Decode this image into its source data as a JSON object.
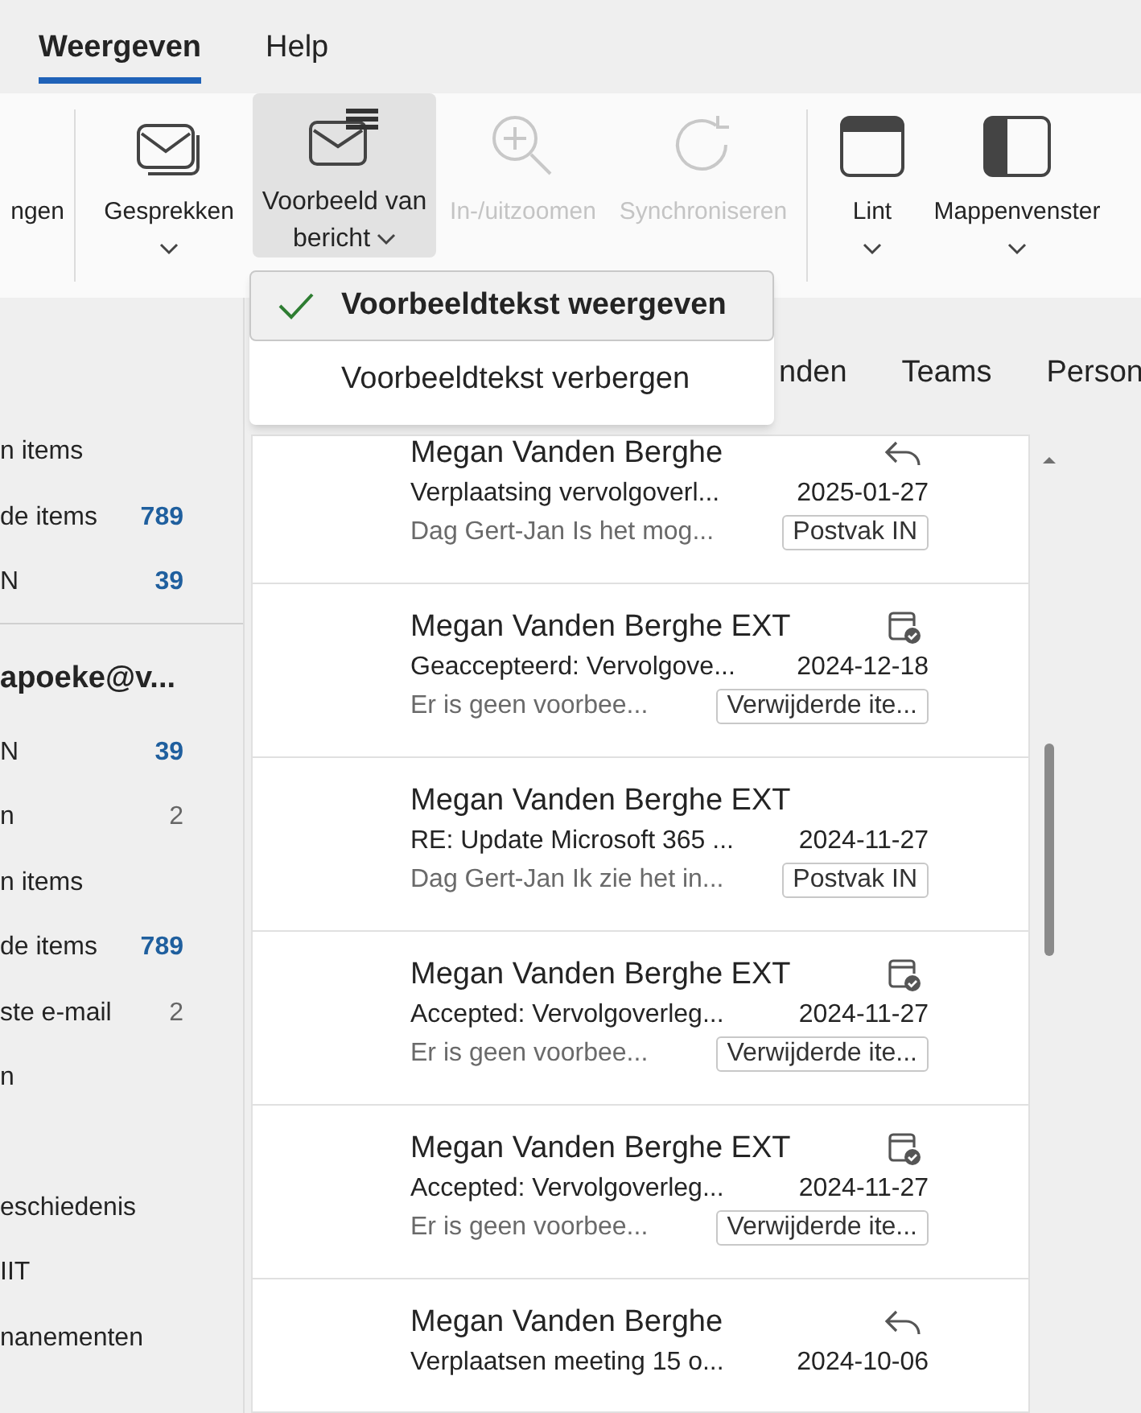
{
  "menu_tabs": [
    {
      "label": "Weergeven",
      "selected": true
    },
    {
      "label": "Help",
      "selected": false
    }
  ],
  "ribbon": {
    "buttons": [
      {
        "label": "ngen",
        "disabled": false,
        "selected": false,
        "dropdown": false
      },
      {
        "label": "Gesprekken",
        "disabled": false,
        "selected": false,
        "dropdown": true
      },
      {
        "label": "Voorbeeld van bericht",
        "disabled": false,
        "selected": true,
        "dropdown": true
      },
      {
        "label": "In-/uitzoomen",
        "disabled": true,
        "selected": false,
        "dropdown": false
      },
      {
        "label": "Synchroniseren",
        "disabled": true,
        "selected": false,
        "dropdown": false
      },
      {
        "label": "Lint",
        "disabled": false,
        "selected": false,
        "dropdown": true
      },
      {
        "label": "Mappenvenster",
        "disabled": false,
        "selected": false,
        "dropdown": true
      }
    ]
  },
  "dropdown_menu": {
    "items": [
      {
        "label": "Voorbeeldtekst weergeven",
        "checked": true
      },
      {
        "label": "Voorbeeldtekst verbergen",
        "checked": false
      }
    ]
  },
  "sidebar": {
    "groups": [
      {
        "items": [
          {
            "label": "n items"
          },
          {
            "label": "de items",
            "count": "789",
            "unread": true
          },
          {
            "label": "N",
            "count": "39",
            "unread": true
          }
        ]
      },
      {
        "header": "apoeke@v...",
        "items": [
          {
            "label": "N",
            "count": "39",
            "unread": true
          },
          {
            "label": "n",
            "count": "2",
            "unread": false
          },
          {
            "label": "n items"
          },
          {
            "label": "de items",
            "count": "789",
            "unread": true
          },
          {
            "label": "ste e-mail",
            "count": "2",
            "unread": false
          },
          {
            "label": "n"
          }
        ]
      },
      {
        "items": [
          {
            "label": "eschiedenis"
          },
          {
            "label": "IIT"
          },
          {
            "label": "nanementen"
          }
        ]
      }
    ]
  },
  "view_tabs": [
    {
      "label": "nden"
    },
    {
      "label": "Teams"
    },
    {
      "label": "Person"
    }
  ],
  "messages": [
    {
      "sender": "Megan Vanden Berghe",
      "kind": "reply",
      "subject": "Verplaatsing vervolgoverl...",
      "date": "2025-01-27",
      "preview": "Dag Gert-Jan Is het mog...",
      "folder": "Postvak IN"
    },
    {
      "sender": "Megan Vanden Berghe EXT",
      "kind": "calendar",
      "subject": "Geaccepteerd: Vervolgove...",
      "date": "2024-12-18",
      "preview": "Er is geen voorbee...",
      "folder": "Verwijderde ite..."
    },
    {
      "sender": "Megan Vanden Berghe EXT",
      "kind": "plain",
      "subject": "RE: Update Microsoft 365 ...",
      "date": "2024-11-27",
      "preview": "Dag Gert-Jan Ik zie het in...",
      "folder": "Postvak IN"
    },
    {
      "sender": "Megan Vanden Berghe EXT",
      "kind": "calendar",
      "subject": "Accepted: Vervolgoverleg...",
      "date": "2024-11-27",
      "preview": "Er is geen voorbee...",
      "folder": "Verwijderde ite..."
    },
    {
      "sender": "Megan Vanden Berghe EXT",
      "kind": "calendar",
      "subject": "Accepted: Vervolgoverleg...",
      "date": "2024-11-27",
      "preview": "Er is geen voorbee...",
      "folder": "Verwijderde ite..."
    },
    {
      "sender": "Megan Vanden Berghe",
      "kind": "reply",
      "subject": "Verplaatsen meeting 15 o...",
      "date": "2024-10-06"
    }
  ]
}
